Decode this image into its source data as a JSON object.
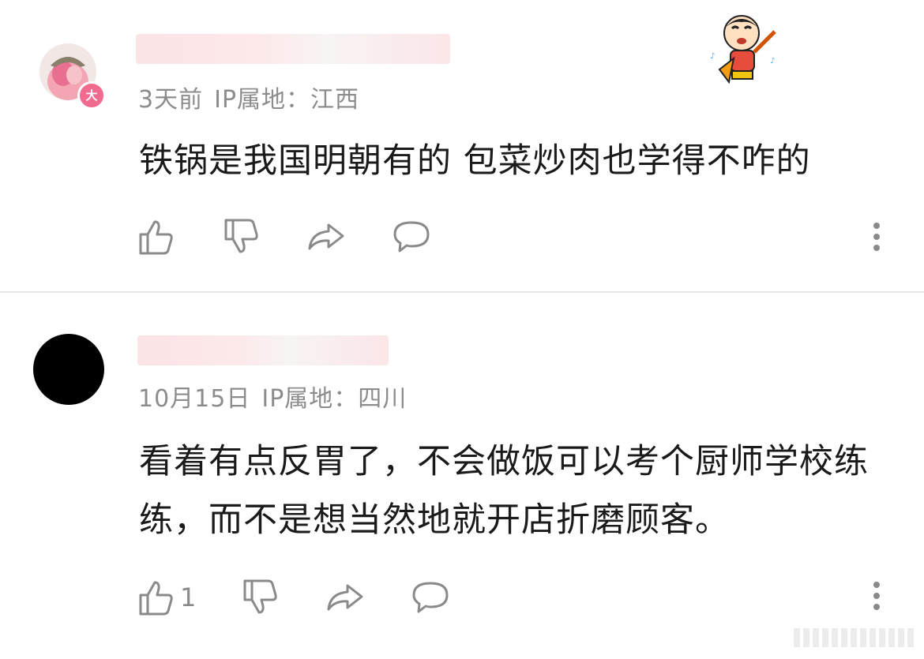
{
  "comments": [
    {
      "avatar": "avatar-illustration",
      "badge": "大",
      "date": "3天前",
      "ip_label": "IP属地：江西",
      "text": "铁锅是我国明朝有的  包菜炒肉也学得不咋的",
      "like_count": "",
      "sticker": "crayon-shinchan-sticker"
    },
    {
      "avatar": "black-circle",
      "date": "10月15日",
      "ip_label": "IP属地：四川",
      "text": "看着有点反胃了，不会做饭可以考个厨师学校练练，而不是想当然地就开店折磨顾客。",
      "like_count": "1"
    }
  ],
  "icons": [
    "thumbs-up-icon",
    "thumbs-down-icon",
    "share-icon",
    "reply-icon",
    "more-icon"
  ],
  "colors": {
    "meta": "#8c8c8c",
    "icon": "#8a8a8a",
    "badge": "#f26a8d",
    "divider": "#e6e6e6"
  }
}
